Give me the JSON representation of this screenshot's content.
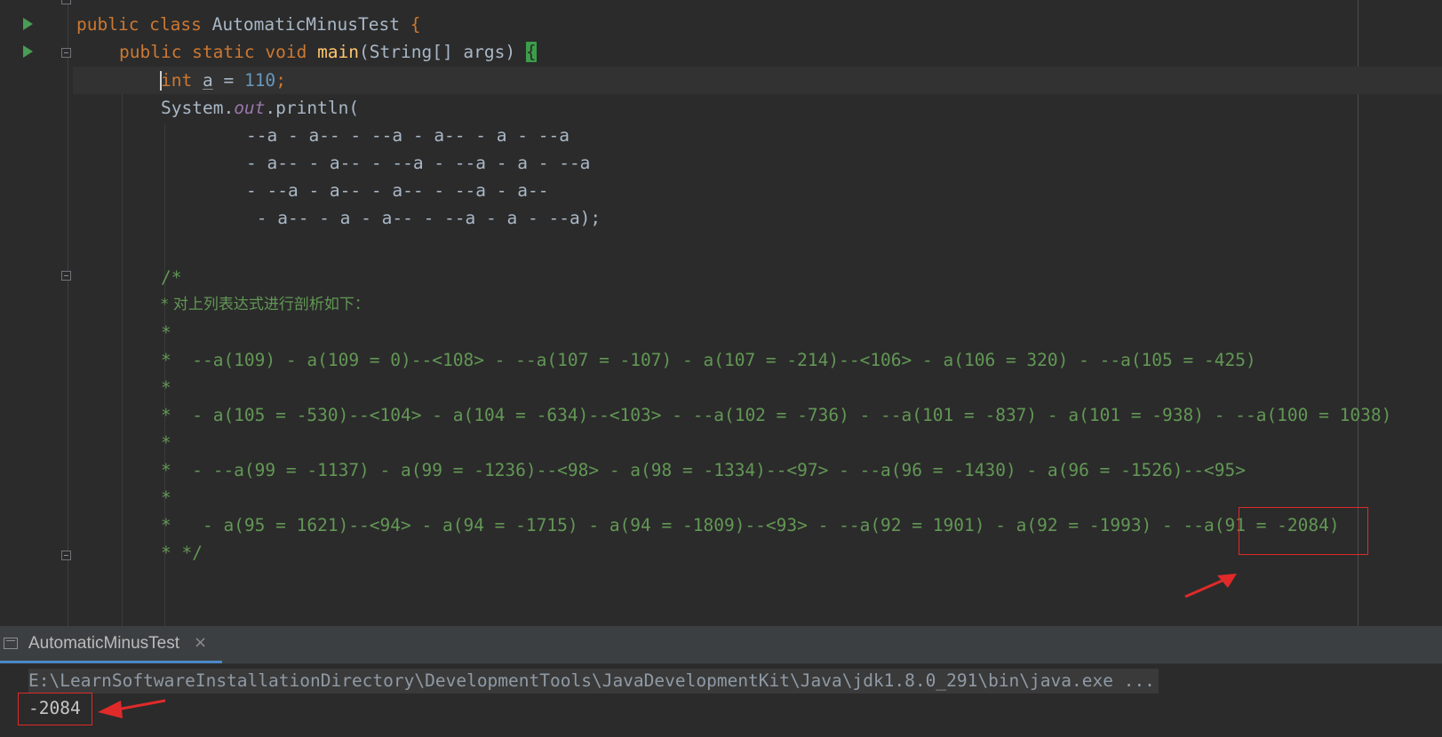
{
  "editor": {
    "code": {
      "l1_kw": "public class ",
      "l1_name": "AutomaticMinusTest",
      "l1_brace": " {",
      "l2_kw": "public static void ",
      "l2_fn": "main",
      "l2_params": "(String[] args) ",
      "l2_brace": "{",
      "l3_kw": "int ",
      "l3_var": "a",
      "l3_eq": " = ",
      "l3_num": "110",
      "l3_semi": ";",
      "l4_sys": "System.",
      "l4_out": "out",
      "l4_print": ".println(",
      "l5": "--a - a-- - --a - a-- - a - --a",
      "l6": "- a-- - a-- - --a - --a - a - --a",
      "l7": "- --a - a-- - a-- - --a - a--",
      "l8": " - a-- - a - a-- - --a - a - --a);"
    },
    "comment": {
      "open": "/*",
      "c1": "* 对上列表达式进行剖析如下：",
      "c2": "*",
      "c3": "*  --a(109) - a(109 = 0)--<108> - --a(107 = -107) - a(107 = -214)--<106> - a(106 = 320) - --a(105 = -425)",
      "c4": "*",
      "c5": "*  - a(105 = -530)--<104> - a(104 = -634)--<103> - --a(102 = -736) - --a(101 = -837) - a(101 = -938) - --a(100 = 1038)",
      "c6": "*",
      "c7": "*  - --a(99 = -1137) - a(99 = -1236)--<98> - a(98 = -1334)--<97> - --a(96 = -1430) - a(96 = -1526)--<95>",
      "c8": "*",
      "c9": "*   - a(95 = 1621)--<94> - a(94 = -1715) - a(94 = -1809)--<93> - --a(92 = 1901) - a(92 = -1993) - --a(91 = -2084)",
      "close": "* */"
    }
  },
  "tool_window": {
    "tab_label": "AutomaticMinusTest",
    "close_glyph": "×",
    "command": "E:\\LearnSoftwareInstallationDirectory\\DevelopmentTools\\JavaDevelopmentKit\\Java\\jdk1.8.0_291\\bin\\java.exe ...",
    "output": "-2084"
  },
  "colors": {
    "keyword": "#cc7832",
    "method": "#ffc66d",
    "number": "#6897bb",
    "comment": "#629755",
    "annotation_box": "#e02a2a",
    "run_icon": "#499c54"
  },
  "icons": [
    "run-icon",
    "fold-icon",
    "console-icon",
    "close-icon",
    "arrow-annotation"
  ]
}
